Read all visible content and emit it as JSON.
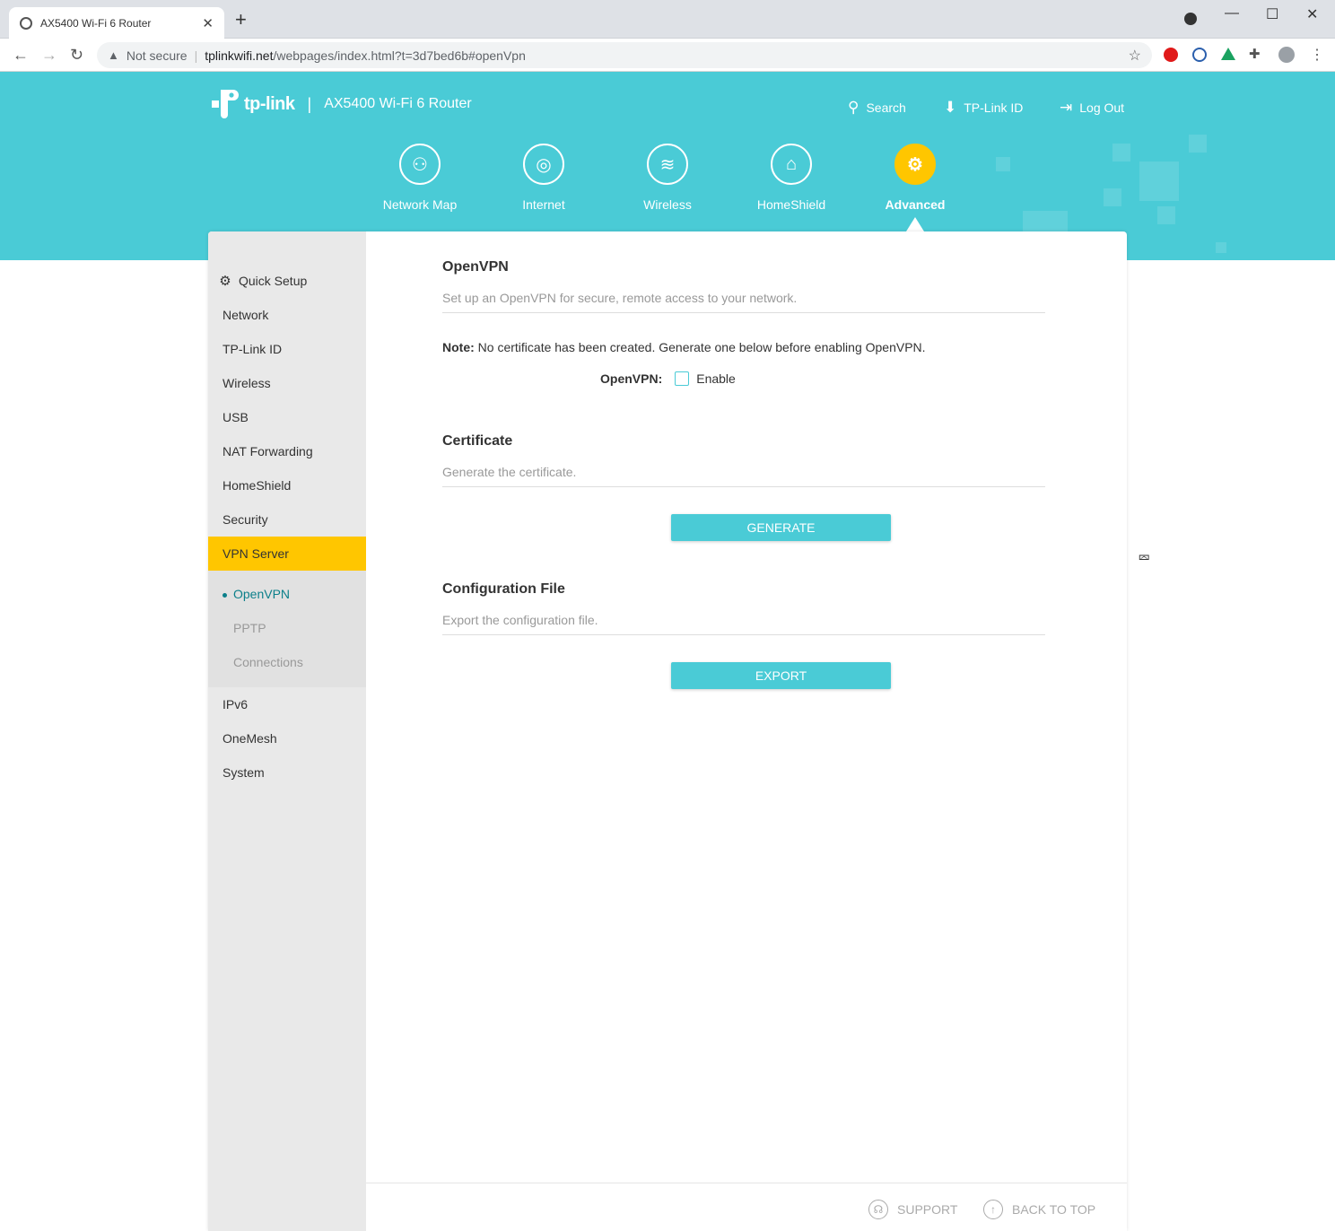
{
  "browser": {
    "tab_title": "AX5400 Wi-Fi 6 Router",
    "tab_close": "✕",
    "new_tab": "+",
    "security_label": "Not secure",
    "url_host": "tplinkwifi.net",
    "url_path": "/webpages/index.html?t=3d7bed6b#openVpn"
  },
  "header": {
    "brand": "tp-link",
    "divider": "|",
    "model": "AX5400 Wi-Fi 6 Router",
    "links": {
      "search": "Search",
      "tplink_id": "TP-Link ID",
      "logout": "Log Out"
    },
    "nav": [
      "Network Map",
      "Internet",
      "Wireless",
      "HomeShield",
      "Advanced"
    ],
    "active_nav": "Advanced",
    "accent": "#4acbd6",
    "highlight": "#ffc600"
  },
  "sidebar": {
    "items": [
      "Quick Setup",
      "Network",
      "TP-Link ID",
      "Wireless",
      "USB",
      "NAT Forwarding",
      "HomeShield",
      "Security",
      "VPN Server",
      "IPv6",
      "OneMesh",
      "System"
    ],
    "active": "VPN Server",
    "sub_items": [
      "OpenVPN",
      "PPTP",
      "Connections"
    ],
    "active_sub": "OpenVPN"
  },
  "content": {
    "openvpn": {
      "title": "OpenVPN",
      "desc": "Set up an OpenVPN for secure, remote access to your network.",
      "note_label": "Note:",
      "note_text": " No certificate has been created. Generate one below before enabling OpenVPN.",
      "field_label": "OpenVPN:",
      "checkbox_label": "Enable",
      "enabled": false
    },
    "certificate": {
      "title": "Certificate",
      "desc": "Generate the certificate.",
      "button": "GENERATE"
    },
    "config_file": {
      "title": "Configuration File",
      "desc": "Export the configuration file.",
      "button": "EXPORT"
    }
  },
  "footer": {
    "support": "SUPPORT",
    "back_to_top": "BACK TO TOP"
  }
}
